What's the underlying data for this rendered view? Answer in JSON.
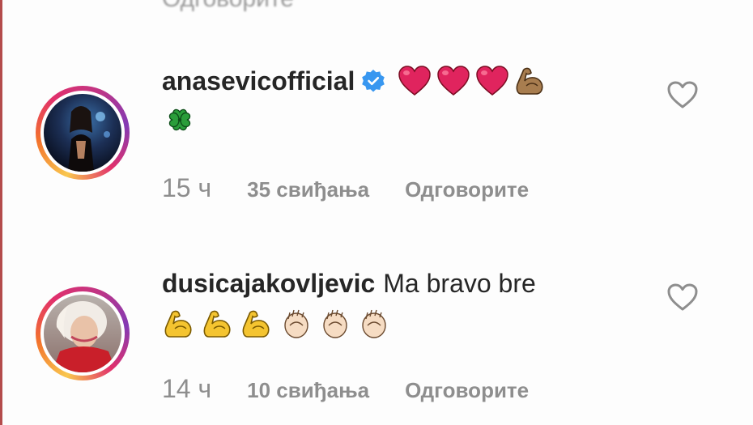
{
  "colors": {
    "text_primary": "#262626",
    "text_secondary": "#8e8e8e",
    "verified_blue": "#3897f0",
    "heart_red": "#e0245e",
    "flex_yellow": "#f4c430",
    "flex_brown": "#a87d4f",
    "clover_green": "#2a9d3a"
  },
  "top_fragment": "Одговорите",
  "comments": [
    {
      "username": "anasevicofficial",
      "verified": true,
      "text": "",
      "emojis_line1": [
        "red-heart",
        "red-heart",
        "red-heart",
        "flexed-biceps-medium"
      ],
      "emojis_line2": [
        "four-leaf-clover"
      ],
      "time": "15 ч",
      "likes": "35 свиђања",
      "reply": "Одговорите"
    },
    {
      "username": "dusicajakovljevic",
      "verified": false,
      "text": "Ma bravo bre",
      "emojis_line1": [],
      "emojis_line2": [
        "flexed-biceps",
        "flexed-biceps",
        "flexed-biceps",
        "clapping-hands",
        "clapping-hands",
        "clapping-hands"
      ],
      "time": "14 ч",
      "likes": "10 свиђања",
      "reply": "Одговорите"
    }
  ]
}
